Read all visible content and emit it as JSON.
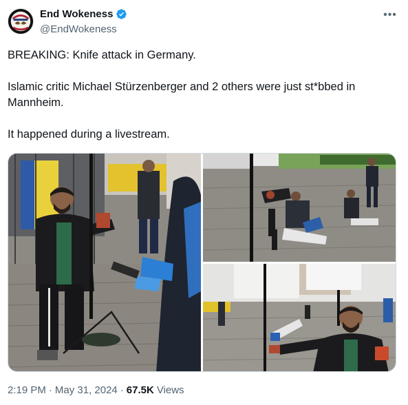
{
  "author": {
    "display_name": "End Wokeness",
    "handle": "@EndWokeness",
    "verified": true,
    "avatar_icon": "eagle-emblem-avatar"
  },
  "more_icon": "more-horizontal-icon",
  "tweet": {
    "paragraphs": [
      "BREAKING: Knife attack in Germany.",
      "Islamic critic Michael Stürzenberger and 2 others were just st*bbed in Mannheim.",
      "It happened during a livestream."
    ]
  },
  "meta": {
    "time": "2:19 PM",
    "date": "May 31, 2024",
    "views_count": "67.5K",
    "views_label": "Views",
    "separator": "·"
  },
  "colors": {
    "text_primary": "#0f1419",
    "text_secondary": "#536471",
    "verified_blue": "#1d9bf0",
    "border": "#cfd9de"
  }
}
